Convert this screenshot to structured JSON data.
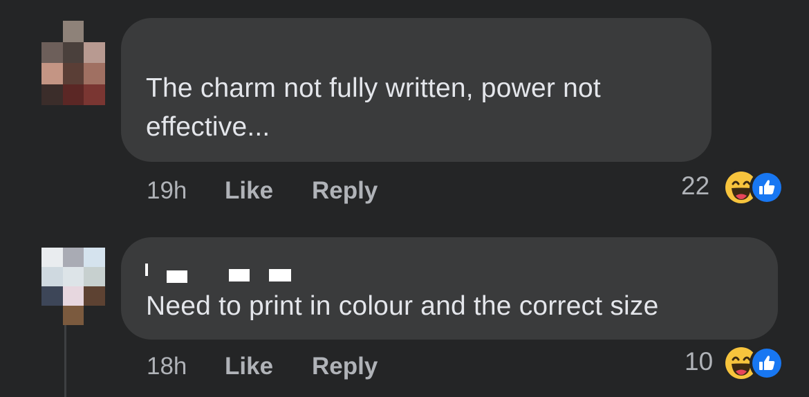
{
  "comments": [
    {
      "author": "",
      "text": "The charm not fully written, power not effective...",
      "line1": "The charm not fully written, power not",
      "line2": "effective...",
      "time": "19h",
      "like_label": "Like",
      "reply_label": "Reply",
      "reaction_count": "22",
      "reactions": [
        "haha-icon",
        "like-icon"
      ]
    },
    {
      "author": "",
      "text": "Need to print in colour and the correct size",
      "time": "18h",
      "like_label": "Like",
      "reply_label": "Reply",
      "reaction_count": "10",
      "reactions": [
        "haha-icon",
        "like-icon"
      ]
    }
  ],
  "colors": {
    "background": "#242526",
    "bubble": "#3a3b3c",
    "text": "#e4e6eb",
    "secondary_text": "#b0b3b8",
    "like_blue": "#1877f2",
    "haha_yellow": "#f7c43d"
  }
}
